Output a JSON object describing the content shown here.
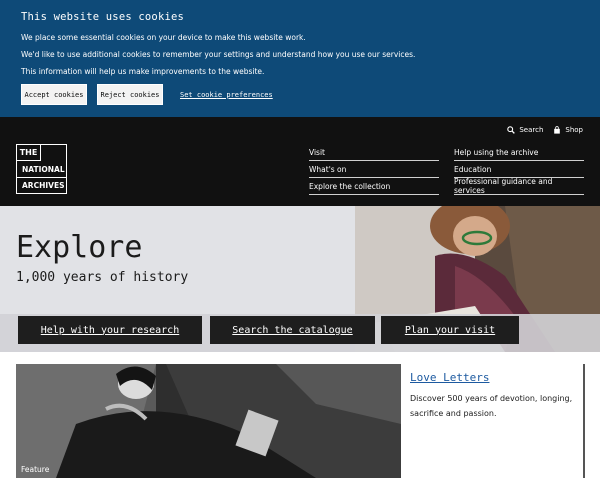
{
  "cookie_banner": {
    "title": "This website uses cookies",
    "line1": "We place some essential cookies on your device to make this website work.",
    "line2": "We'd like to use additional cookies to remember your settings and understand how you use our services.",
    "line3": "This information will help us make improvements to the website.",
    "accept_label": "Accept cookies",
    "reject_label": "Reject cookies",
    "preferences_label": "Set cookie preferences"
  },
  "header": {
    "utility": {
      "search_label": "Search",
      "shop_label": "Shop"
    },
    "logo": {
      "line1": "THE",
      "line2": "NATIONAL",
      "line3": "ARCHIVES"
    },
    "nav_col1": [
      "Visit",
      "What's on",
      "Explore the collection"
    ],
    "nav_col2": [
      "Help using the archive",
      "Education",
      "Professional guidance and services"
    ]
  },
  "hero": {
    "title": "Explore",
    "subtitle": "1,000 years of history",
    "buttons": [
      "Help with your research",
      "Search the catalogue",
      "Plan your visit"
    ]
  },
  "feature": {
    "tag": "Feature",
    "title": "Love Letters",
    "description": "Discover 500 years of devotion, longing, sacrifice and passion."
  },
  "icons": {
    "search": "search-icon",
    "shop": "shopping-bag-icon"
  },
  "colors": {
    "banner_bg": "#0e4a78",
    "header_bg": "#111111",
    "hero_bg": "#e1e2e6",
    "link": "#1d5aa0"
  }
}
